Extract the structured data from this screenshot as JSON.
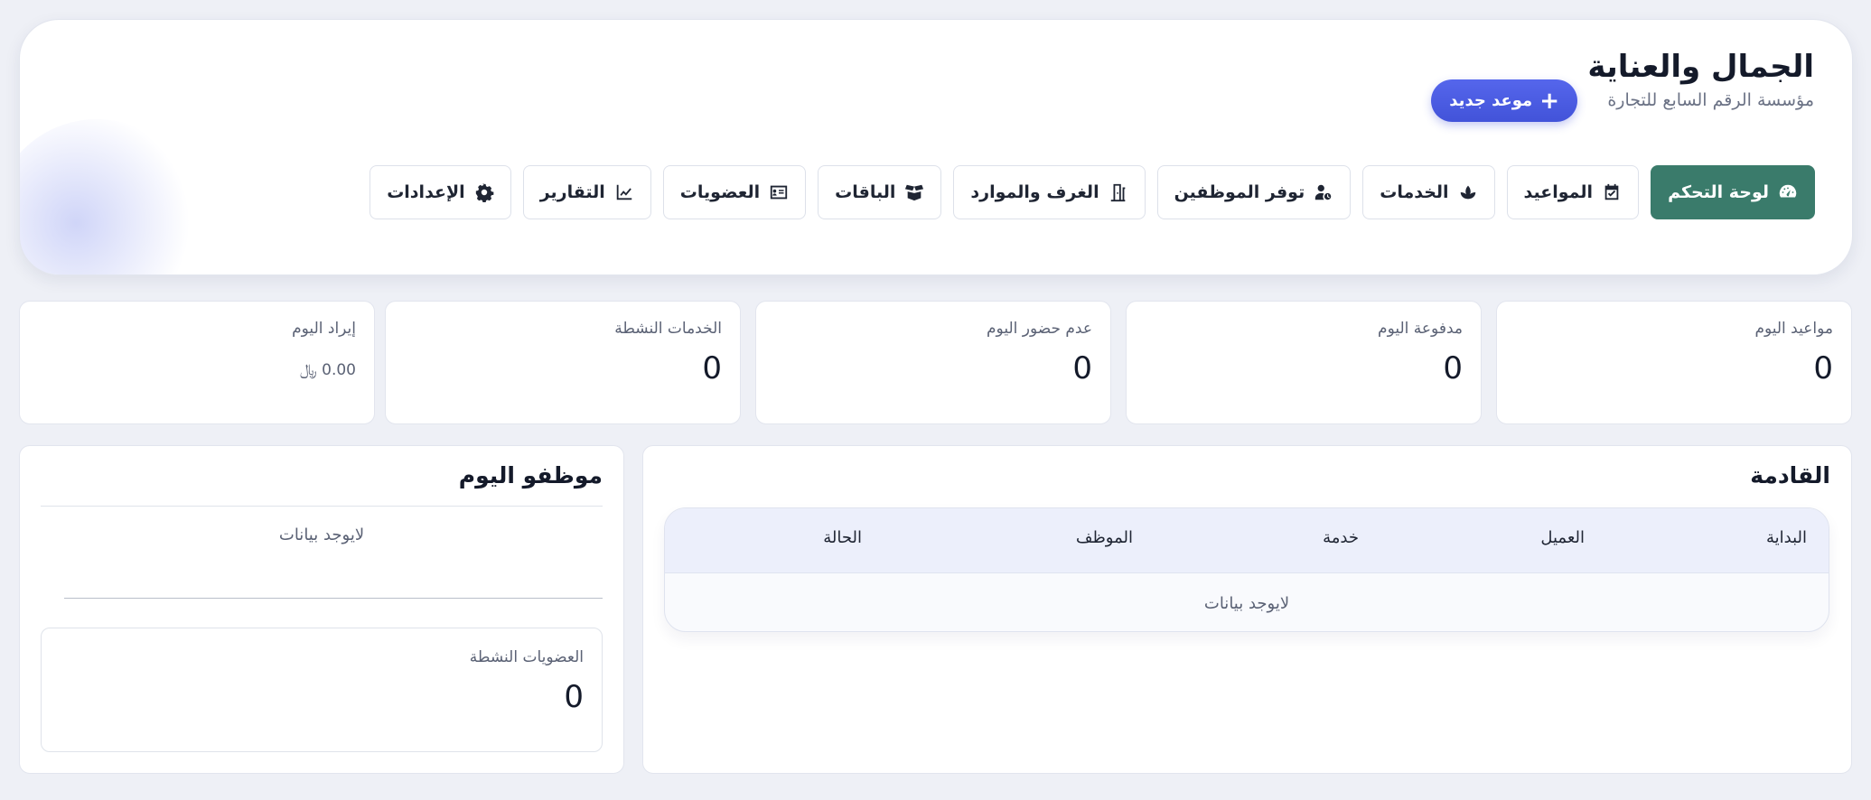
{
  "header": {
    "title": "الجمال والعناية",
    "subtitle": "مؤسسة الرقم السابع للتجارة",
    "new_appointment_label": "موعد جديد"
  },
  "nav": {
    "items": [
      {
        "label": "لوحة التحكم",
        "icon": "dashboard-gauge-icon",
        "active": true
      },
      {
        "label": "المواعيد",
        "icon": "calendar-check-icon",
        "active": false
      },
      {
        "label": "الخدمات",
        "icon": "spa-lotus-icon",
        "active": false
      },
      {
        "label": "توفر الموظفين",
        "icon": "user-clock-icon",
        "active": false
      },
      {
        "label": "الغرف والموارد",
        "icon": "door-icon",
        "active": false
      },
      {
        "label": "الباقات",
        "icon": "box-open-icon",
        "active": false
      },
      {
        "label": "العضويات",
        "icon": "id-card-icon",
        "active": false
      },
      {
        "label": "التقارير",
        "icon": "chart-line-icon",
        "active": false
      },
      {
        "label": "الإعدادات",
        "icon": "gear-icon",
        "active": false
      }
    ]
  },
  "stats": [
    {
      "label": "مواعيد اليوم",
      "value": "0"
    },
    {
      "label": "مدفوعة اليوم",
      "value": "0"
    },
    {
      "label": "عدم حضور اليوم",
      "value": "0"
    },
    {
      "label": "الخدمات النشطة",
      "value": "0"
    },
    {
      "label": "إيراد اليوم",
      "value": "0.00 ﷼"
    }
  ],
  "upcoming": {
    "title": "القادمة",
    "columns": [
      "البداية",
      "العميل",
      "خدمة",
      "الموظف",
      "الحالة"
    ],
    "empty_text": "لايوجد بيانات"
  },
  "staff_today": {
    "title": "موظفو اليوم",
    "empty_text": "لايوجد بيانات",
    "memberships_label": "العضويات النشطة",
    "memberships_value": "0"
  },
  "colors": {
    "active_nav": "#3a7b6b",
    "primary_button": "#4a5be3",
    "page_bg": "#eef0f6"
  }
}
